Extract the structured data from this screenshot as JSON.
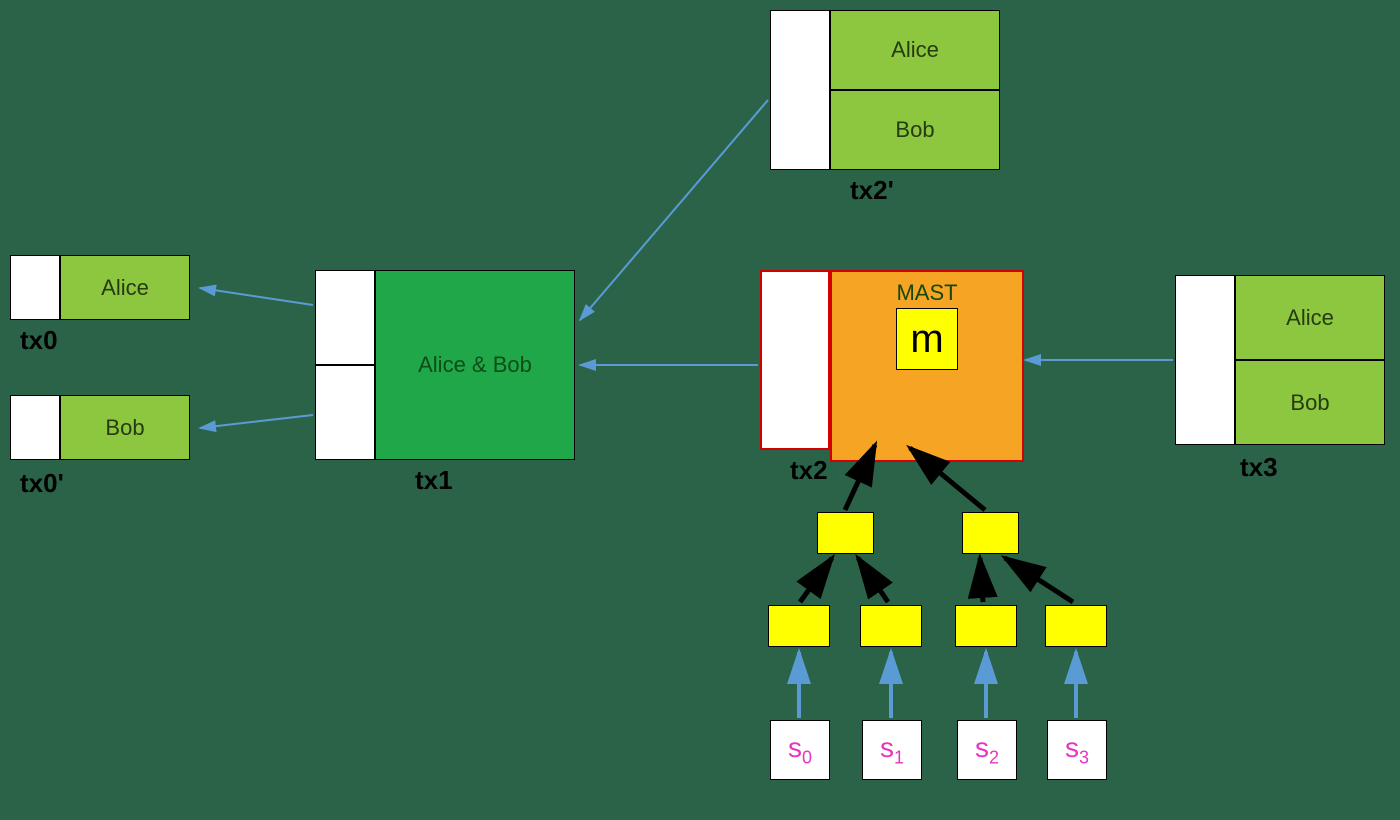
{
  "tx0": {
    "label": "tx0",
    "out": "Alice"
  },
  "tx0p": {
    "label": "tx0'",
    "out": "Bob"
  },
  "tx1": {
    "label": "tx1",
    "out": "Alice & Bob"
  },
  "tx2p": {
    "label": "tx2'",
    "out1": "Alice",
    "out2": "Bob"
  },
  "tx2": {
    "label": "tx2",
    "mast_label": "MAST",
    "m": "m"
  },
  "tx3": {
    "label": "tx3",
    "out1": "Alice",
    "out2": "Bob"
  },
  "leaves": {
    "s0": "s",
    "s0_sub": "0",
    "s1": "s",
    "s1_sub": "1",
    "s2": "s",
    "s2_sub": "2",
    "s3": "s",
    "s3_sub": "3"
  },
  "colors": {
    "bg": "#2b6349",
    "light_green": "#8dc63f",
    "dark_green": "#20a74a",
    "orange": "#f5a423",
    "yellow": "#ffff00",
    "red": "#d40000",
    "blue_arrow": "#5b9bd5",
    "black_arrow": "#000000",
    "leaf_text": "#e835c1"
  }
}
